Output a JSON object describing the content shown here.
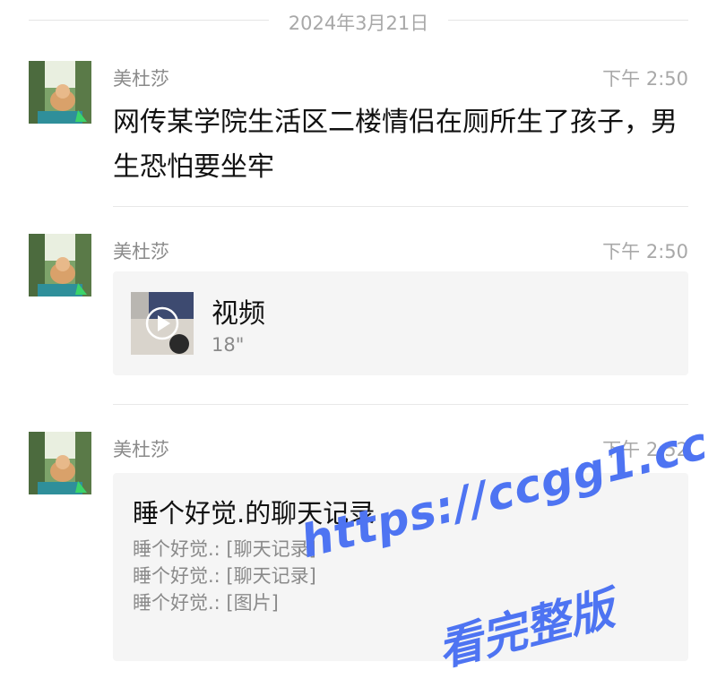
{
  "date_divider": "2024年3月21日",
  "messages": [
    {
      "sender": "美杜莎",
      "time": "下午 2:50",
      "text": "网传某学院生活区二楼情侣在厕所生了孩子，男生恐怕要坐牢"
    },
    {
      "sender": "美杜莎",
      "time": "下午 2:50",
      "video": {
        "title": "视频",
        "duration": "18\""
      }
    },
    {
      "sender": "美杜莎",
      "time": "下午 2:52",
      "record": {
        "title": "睡个好觉.的聊天记录",
        "lines": [
          "睡个好觉.: [聊天记录]",
          "睡个好觉.: [聊天记录]",
          "睡个好觉.: [图片]"
        ]
      }
    }
  ],
  "watermark": {
    "line1": "https://ccgg1.cc",
    "line2": "看完整版"
  },
  "colors": {
    "watermark": "#4e74f2",
    "card_bg": "#f5f5f5",
    "muted": "#8a8a8a"
  }
}
